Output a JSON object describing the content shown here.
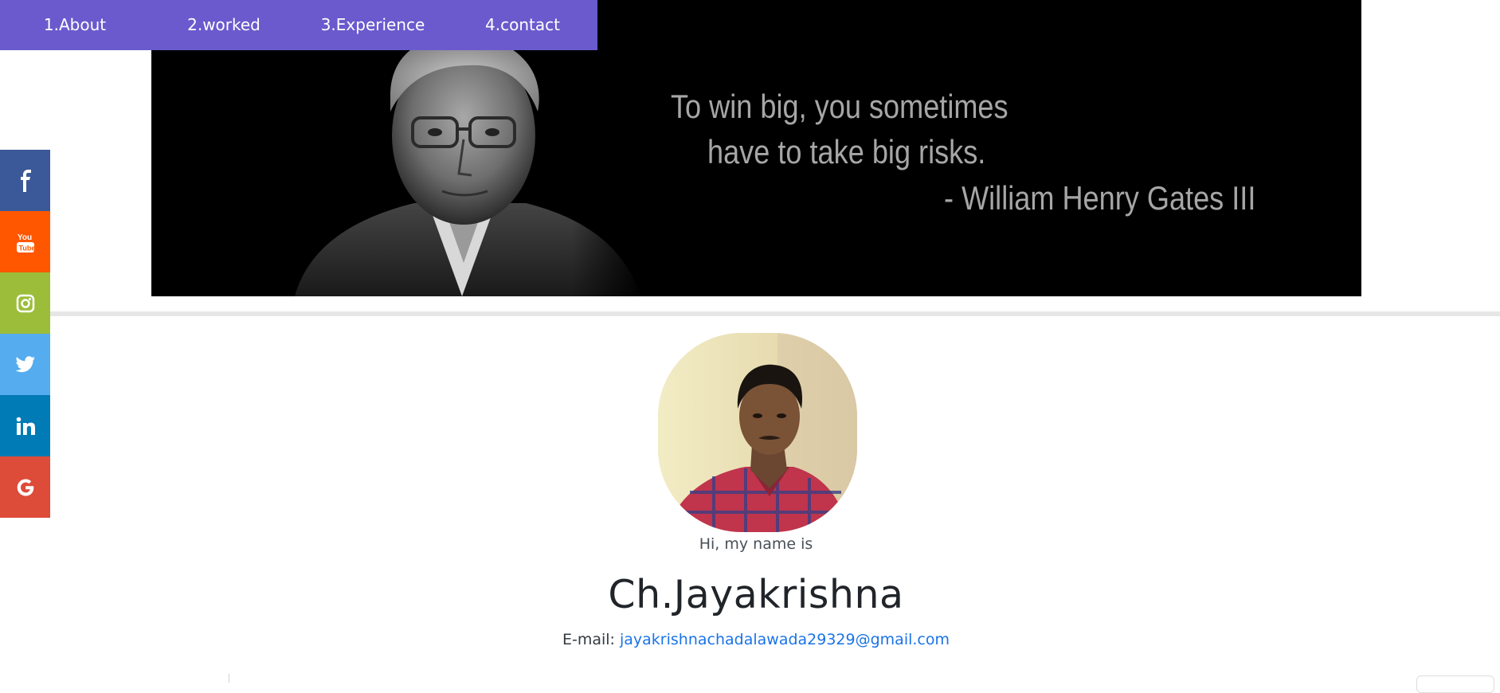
{
  "nav": {
    "items": [
      {
        "label": "1.About"
      },
      {
        "label": "2.worked"
      },
      {
        "label": "3.Experience"
      },
      {
        "label": "4.contact"
      }
    ]
  },
  "banner": {
    "quote_line1": "To win big, you sometimes",
    "quote_line2": "have to take big risks.",
    "quote_author": "- William Henry Gates III"
  },
  "social": {
    "items": [
      {
        "icon": "facebook-icon",
        "color": "#3b5998"
      },
      {
        "icon": "youtube-icon",
        "color": "#ff5700"
      },
      {
        "icon": "instagram-icon",
        "color": "#9bbd3a"
      },
      {
        "icon": "twitter-icon",
        "color": "#55acee"
      },
      {
        "icon": "linkedin-icon",
        "color": "#007bb5"
      },
      {
        "icon": "google-icon",
        "color": "#dd4b39"
      }
    ]
  },
  "profile": {
    "greeting": "Hi, my name is",
    "name": "Ch.Jayakrishna",
    "email_label": "E-mail:",
    "email": "jayakrishnachadalawada29329@gmail.com"
  },
  "colors": {
    "nav_bg": "#6a5acd",
    "link": "#1a73e8"
  }
}
